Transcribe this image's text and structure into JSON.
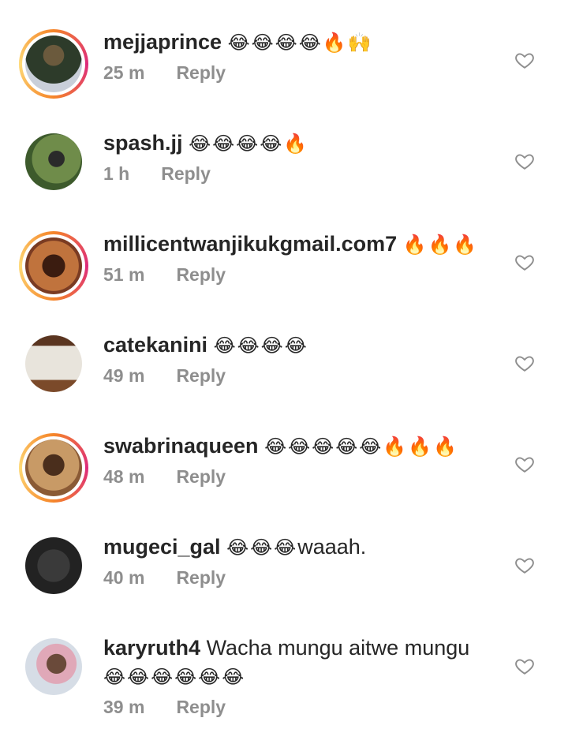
{
  "comments": [
    {
      "username": "mejjaprince",
      "text": "",
      "emojis": "😂😂😂😂🔥🙌",
      "time": "25 m",
      "reply": "Reply",
      "story": true,
      "avatar_colors": [
        "#6b5a3d",
        "#2d3b2a",
        "#c9cfd9"
      ]
    },
    {
      "username": "spash.jj",
      "text": "",
      "emojis": "😂😂😂😂🔥",
      "time": "1 h",
      "reply": "Reply",
      "story": false,
      "avatar_colors": [
        "#3d5a2c",
        "#6f8c4a",
        "#2a2a2a"
      ]
    },
    {
      "username": "millicentwanjikukgmail.com7",
      "text": "",
      "emojis": "🔥🔥🔥",
      "time": "51 m",
      "reply": "Reply",
      "story": true,
      "avatar_colors": [
        "#7a3b22",
        "#c0733d",
        "#3b1c10"
      ]
    },
    {
      "username": "catekanini",
      "text": "",
      "emojis": "😂😂😂😂",
      "time": "49 m",
      "reply": "Reply",
      "story": false,
      "avatar_colors": [
        "#5a3520",
        "#e8e4dc",
        "#7b4a2a"
      ]
    },
    {
      "username": "swabrinaqueen",
      "text": "",
      "emojis": "😂😂😂😂😂🔥🔥🔥",
      "time": "48 m",
      "reply": "Reply",
      "story": true,
      "avatar_colors": [
        "#8a5a35",
        "#c89a66",
        "#4a2e1c"
      ]
    },
    {
      "username": "mugeci_gal",
      "text": "waaah.",
      "emojis": "😂😂😂",
      "time": "40 m",
      "reply": "Reply",
      "story": false,
      "avatar_colors": [
        "#222222",
        "#3a3a3a",
        "#bbbbbb"
      ]
    },
    {
      "username": "karyruth4",
      "text": "Wacha mungu aitwe mungu",
      "emojis": "😂😂😂😂😂😂",
      "time": "39 m",
      "reply": "Reply",
      "story": false,
      "avatar_colors": [
        "#d6dde6",
        "#6a4a3a",
        "#e0a8b8"
      ]
    }
  ]
}
